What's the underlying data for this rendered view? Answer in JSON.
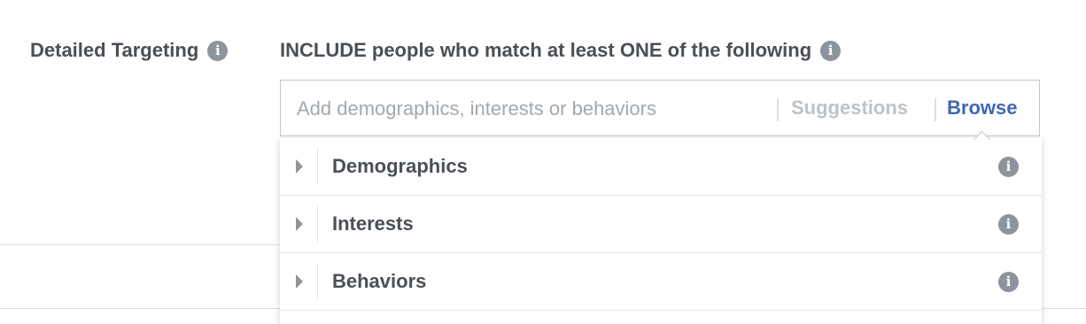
{
  "targeting": {
    "label": "Detailed Targeting",
    "include_text": "INCLUDE people who match at least ONE of the following",
    "search_placeholder": "Add demographics, interests or behaviors",
    "suggestions_label": "Suggestions",
    "browse_label": "Browse"
  },
  "dropdown": {
    "items": [
      {
        "label": "Demographics"
      },
      {
        "label": "Interests"
      },
      {
        "label": "Behaviors"
      }
    ]
  },
  "icons": {
    "info": "info-icon",
    "expand": "chevron-right-icon"
  },
  "colors": {
    "text": "#4b4f56",
    "link": "#4267b2",
    "muted": "#bec3c9",
    "icon": "#8d949e"
  }
}
